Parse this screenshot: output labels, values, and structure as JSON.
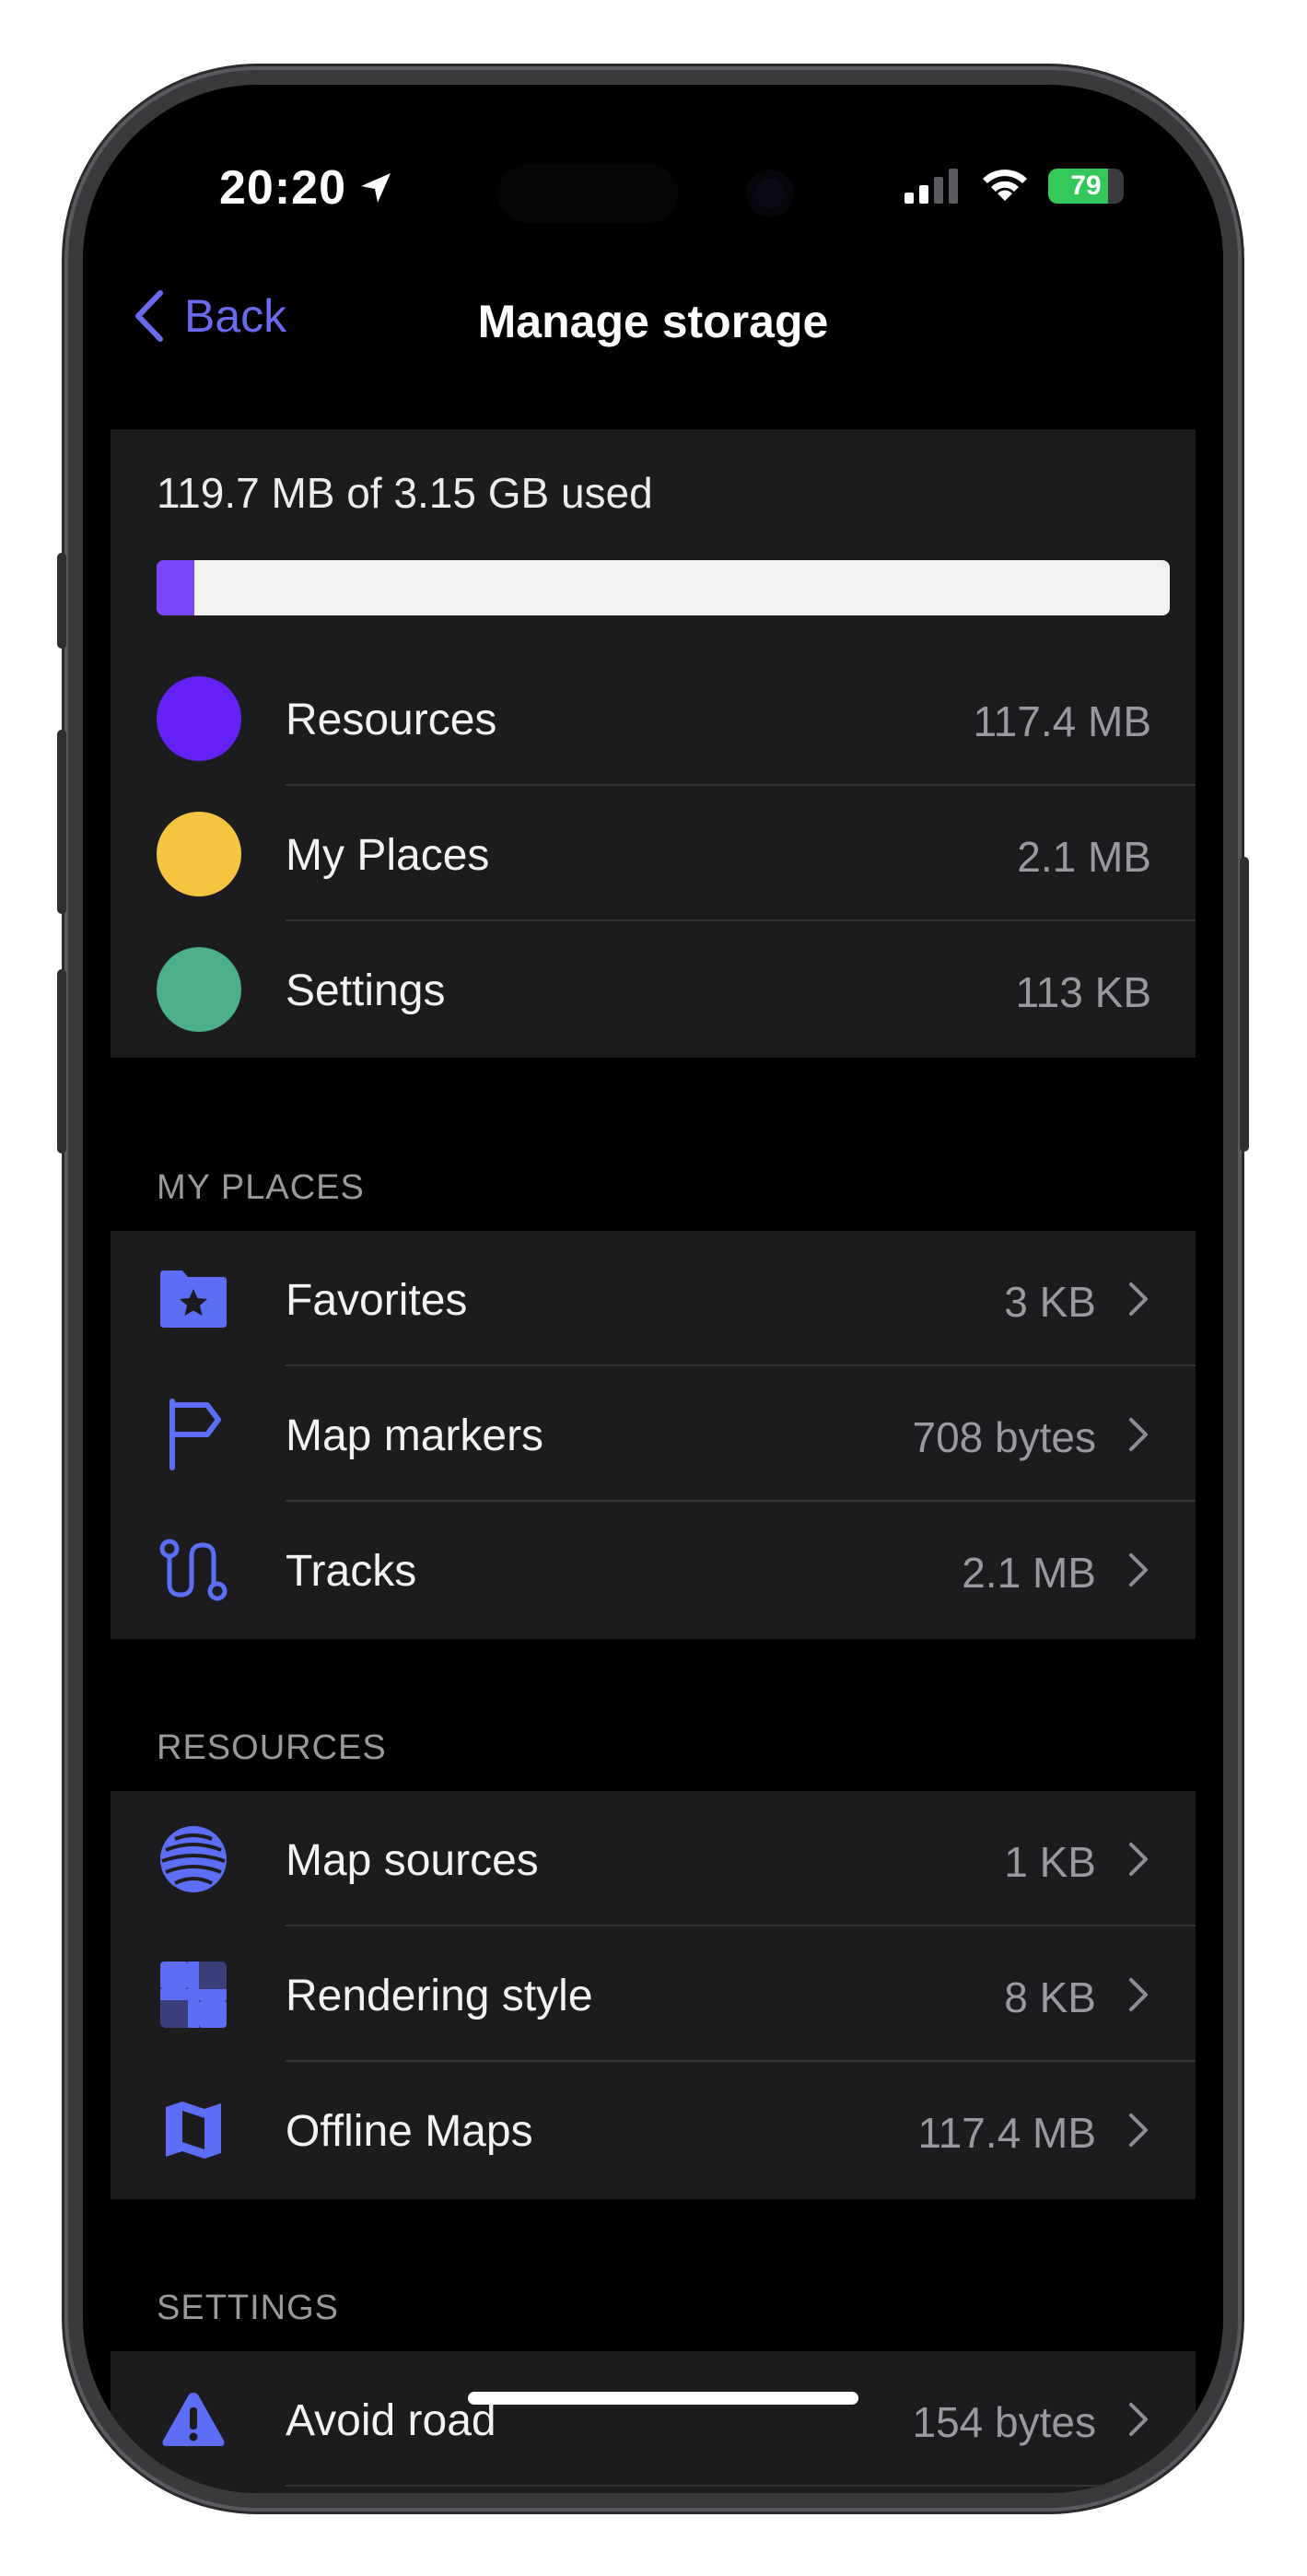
{
  "status_bar": {
    "time": "20:20",
    "battery_percent": "79"
  },
  "nav": {
    "back_label": "Back",
    "title": "Manage storage"
  },
  "usage": {
    "summary": "119.7 MB of 3.15 GB used",
    "fill_fraction": 0.037,
    "fill_color": "#7b44f6",
    "categories": [
      {
        "label": "Resources",
        "value": "117.4 MB",
        "color": "#6422f5"
      },
      {
        "label": "My Places",
        "value": "2.1 MB",
        "color": "#f5c542"
      },
      {
        "label": "Settings",
        "value": "113 KB",
        "color": "#4caf8a"
      }
    ]
  },
  "my_places": {
    "header": "MY PLACES",
    "items": [
      {
        "label": "Favorites",
        "value": "3 KB",
        "icon": "folder-star-icon"
      },
      {
        "label": "Map markers",
        "value": "708 bytes",
        "icon": "flag-icon"
      },
      {
        "label": "Tracks",
        "value": "2.1 MB",
        "icon": "route-icon"
      }
    ]
  },
  "resources": {
    "header": "RESOURCES",
    "items": [
      {
        "label": "Map sources",
        "value": "1 KB",
        "icon": "globe-layers-icon"
      },
      {
        "label": "Rendering style",
        "value": "8 KB",
        "icon": "grid-style-icon"
      },
      {
        "label": "Offline Maps",
        "value": "117.4 MB",
        "icon": "map-icon"
      }
    ]
  },
  "settings": {
    "header": "SETTINGS",
    "items": [
      {
        "label": "Avoid road",
        "value": "154 bytes",
        "icon": "warning-icon"
      }
    ]
  },
  "colors": {
    "accent": "#6a6af0",
    "icon": "#5b6ef5",
    "card_bg": "#1c1c1e"
  }
}
